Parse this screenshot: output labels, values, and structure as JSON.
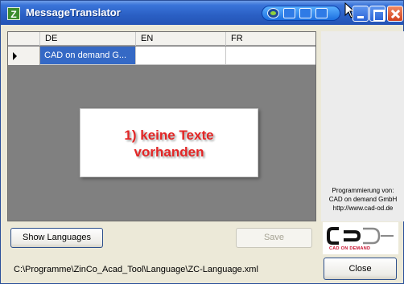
{
  "window": {
    "title": "MessageTranslator",
    "app_icon": "Z"
  },
  "grid": {
    "columns": [
      "DE",
      "EN",
      "FR"
    ],
    "rows": [
      {
        "DE": "CAD on demand G...",
        "EN": "",
        "FR": ""
      }
    ]
  },
  "notice": {
    "text": "1) keine Texte\nvorhanden"
  },
  "credit": {
    "line1": "Programmierung von:",
    "line2": "CAD on demand GmbH",
    "line3": "http://www.cad-od.de"
  },
  "logo": {
    "tagline": "CAD ON DEMAND"
  },
  "buttons": {
    "show_languages": "Show Languages",
    "save": "Save",
    "close": "Close"
  },
  "status": {
    "path": "C:\\Programme\\ZinCo_Acad_Tool\\Language\\ZC-Language.xml"
  },
  "colors": {
    "selection": "#3569c5",
    "notice_text": "#e32626",
    "titlebar": "#2a5fc4"
  }
}
